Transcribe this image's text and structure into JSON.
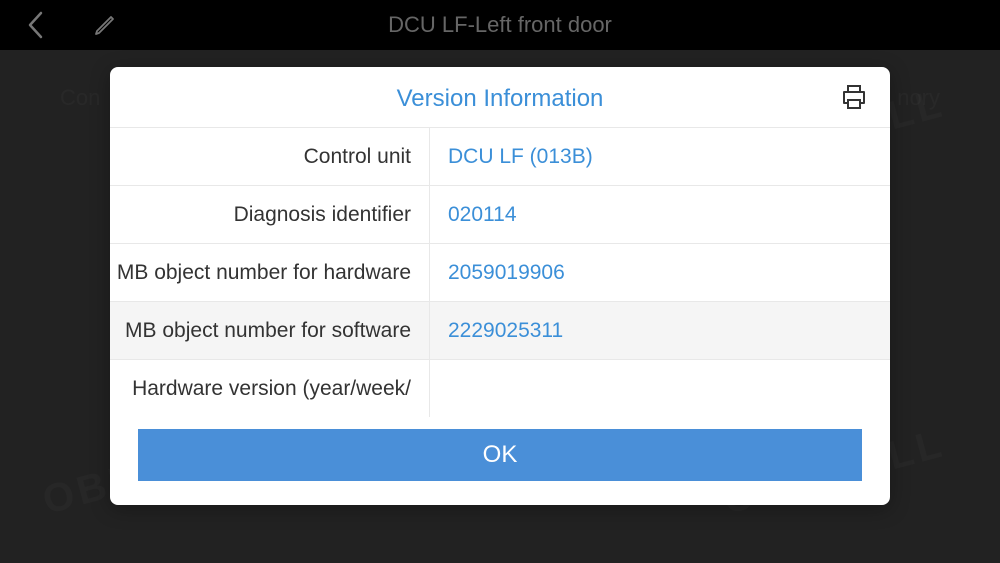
{
  "header": {
    "title": "DCU LF-Left front door"
  },
  "background": {
    "tab_left_partial": "Con",
    "tab_right_partial": "nory"
  },
  "modal": {
    "title": "Version Information",
    "ok_label": "OK",
    "rows": [
      {
        "label": "Control unit",
        "value": "DCU LF (013B)"
      },
      {
        "label": "Diagnosis identifier",
        "value": "020114"
      },
      {
        "label": "MB object number for hardware",
        "value": "2059019906"
      },
      {
        "label": "MB object number for software",
        "value": "2229025311"
      },
      {
        "label": "Hardware version (year/week/",
        "value": ""
      }
    ]
  },
  "watermark": "OBDMALL"
}
